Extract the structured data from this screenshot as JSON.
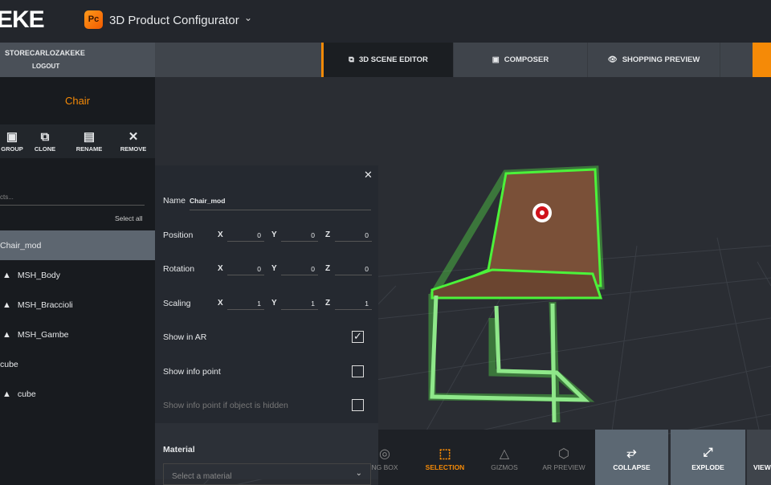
{
  "header": {
    "logo": "EKE",
    "app_badge": "Pc",
    "app_title": "3D Product Configurator",
    "accent": "#f58a07"
  },
  "user": {
    "name": "STORECARLOZAKEKE",
    "logout": "LOGOUT"
  },
  "tabs": [
    {
      "label": "3D SCENE EDITOR",
      "icon": "layers-icon",
      "active": true
    },
    {
      "label": "COMPOSER",
      "icon": "shapes-icon"
    },
    {
      "label": "SHOPPING PREVIEW",
      "icon": "eye-icon"
    }
  ],
  "panel": {
    "title": "Chair",
    "tools": [
      {
        "label": "GROUP",
        "icon": "group-icon",
        "visible": "OUP"
      },
      {
        "label": "CLONE",
        "icon": "clone-icon"
      },
      {
        "label": "RENAME",
        "icon": "rename-icon"
      },
      {
        "label": "REMOVE",
        "icon": "close-icon"
      }
    ],
    "search_placeholder": "cts...",
    "select_all": "Select all",
    "items": [
      {
        "label": "Chair_mod",
        "selected": true,
        "mesh": false
      },
      {
        "label": "MSH_Body",
        "mesh": true
      },
      {
        "label": "MSH_Braccioli",
        "mesh": true
      },
      {
        "label": "MSH_Gambe",
        "mesh": true
      },
      {
        "label": "cube",
        "mesh": false
      },
      {
        "label": "cube",
        "mesh": true
      }
    ]
  },
  "props": {
    "name_label": "Name",
    "name_value": "Chair_mod",
    "position_label": "Position",
    "rotation_label": "Rotation",
    "scaling_label": "Scaling",
    "axes": [
      "X",
      "Y",
      "Z"
    ],
    "position": [
      "0",
      "0",
      "0"
    ],
    "rotation": [
      "0",
      "0",
      "0"
    ],
    "scaling": [
      "1",
      "1",
      "1"
    ],
    "show_ar": "Show in AR",
    "show_ar_checked": true,
    "show_info": "Show info point",
    "show_info_checked": false,
    "show_info_hidden": "Show info point if object is hidden",
    "show_info_hidden_checked": false,
    "material_label": "Material",
    "material_placeholder": "Select a material"
  },
  "bottom": {
    "tools": [
      {
        "label": "NG BOX",
        "icon": "bounding-box-icon"
      },
      {
        "label": "SELECTION",
        "icon": "selection-icon",
        "active": true
      },
      {
        "label": "GIZMOS",
        "icon": "gizmo-icon"
      },
      {
        "label": "AR PREVIEW",
        "icon": "ar-icon"
      }
    ],
    "collapse": "COLLAPSE",
    "explode": "EXPLODE",
    "view": "VIEW"
  }
}
